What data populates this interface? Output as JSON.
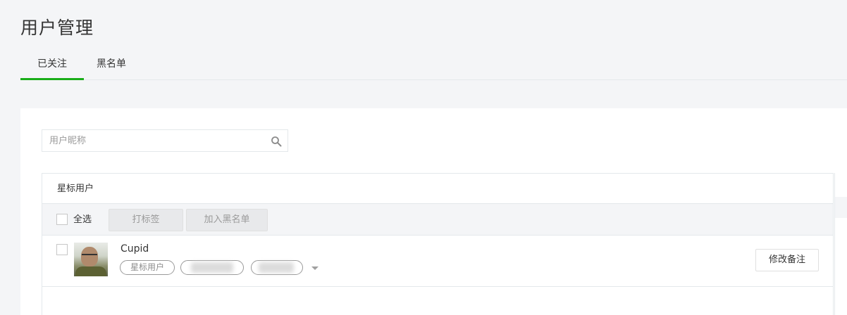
{
  "page": {
    "title": "用户管理"
  },
  "tabs": [
    {
      "label": "已关注",
      "active": true
    },
    {
      "label": "黑名单",
      "active": false
    }
  ],
  "search": {
    "placeholder": "用户昵称",
    "value": ""
  },
  "table": {
    "group_title": "星标用户",
    "toolbar": {
      "select_all_label": "全选",
      "tag_button": "打标签",
      "blacklist_button": "加入黑名单"
    },
    "users": [
      {
        "name": "Cupid",
        "tags": [
          "星标用户"
        ],
        "remark_button": "修改备注"
      }
    ]
  },
  "colors": {
    "accent": "#1aad19",
    "background": "#f4f5f7",
    "border": "#e4e8eb"
  }
}
